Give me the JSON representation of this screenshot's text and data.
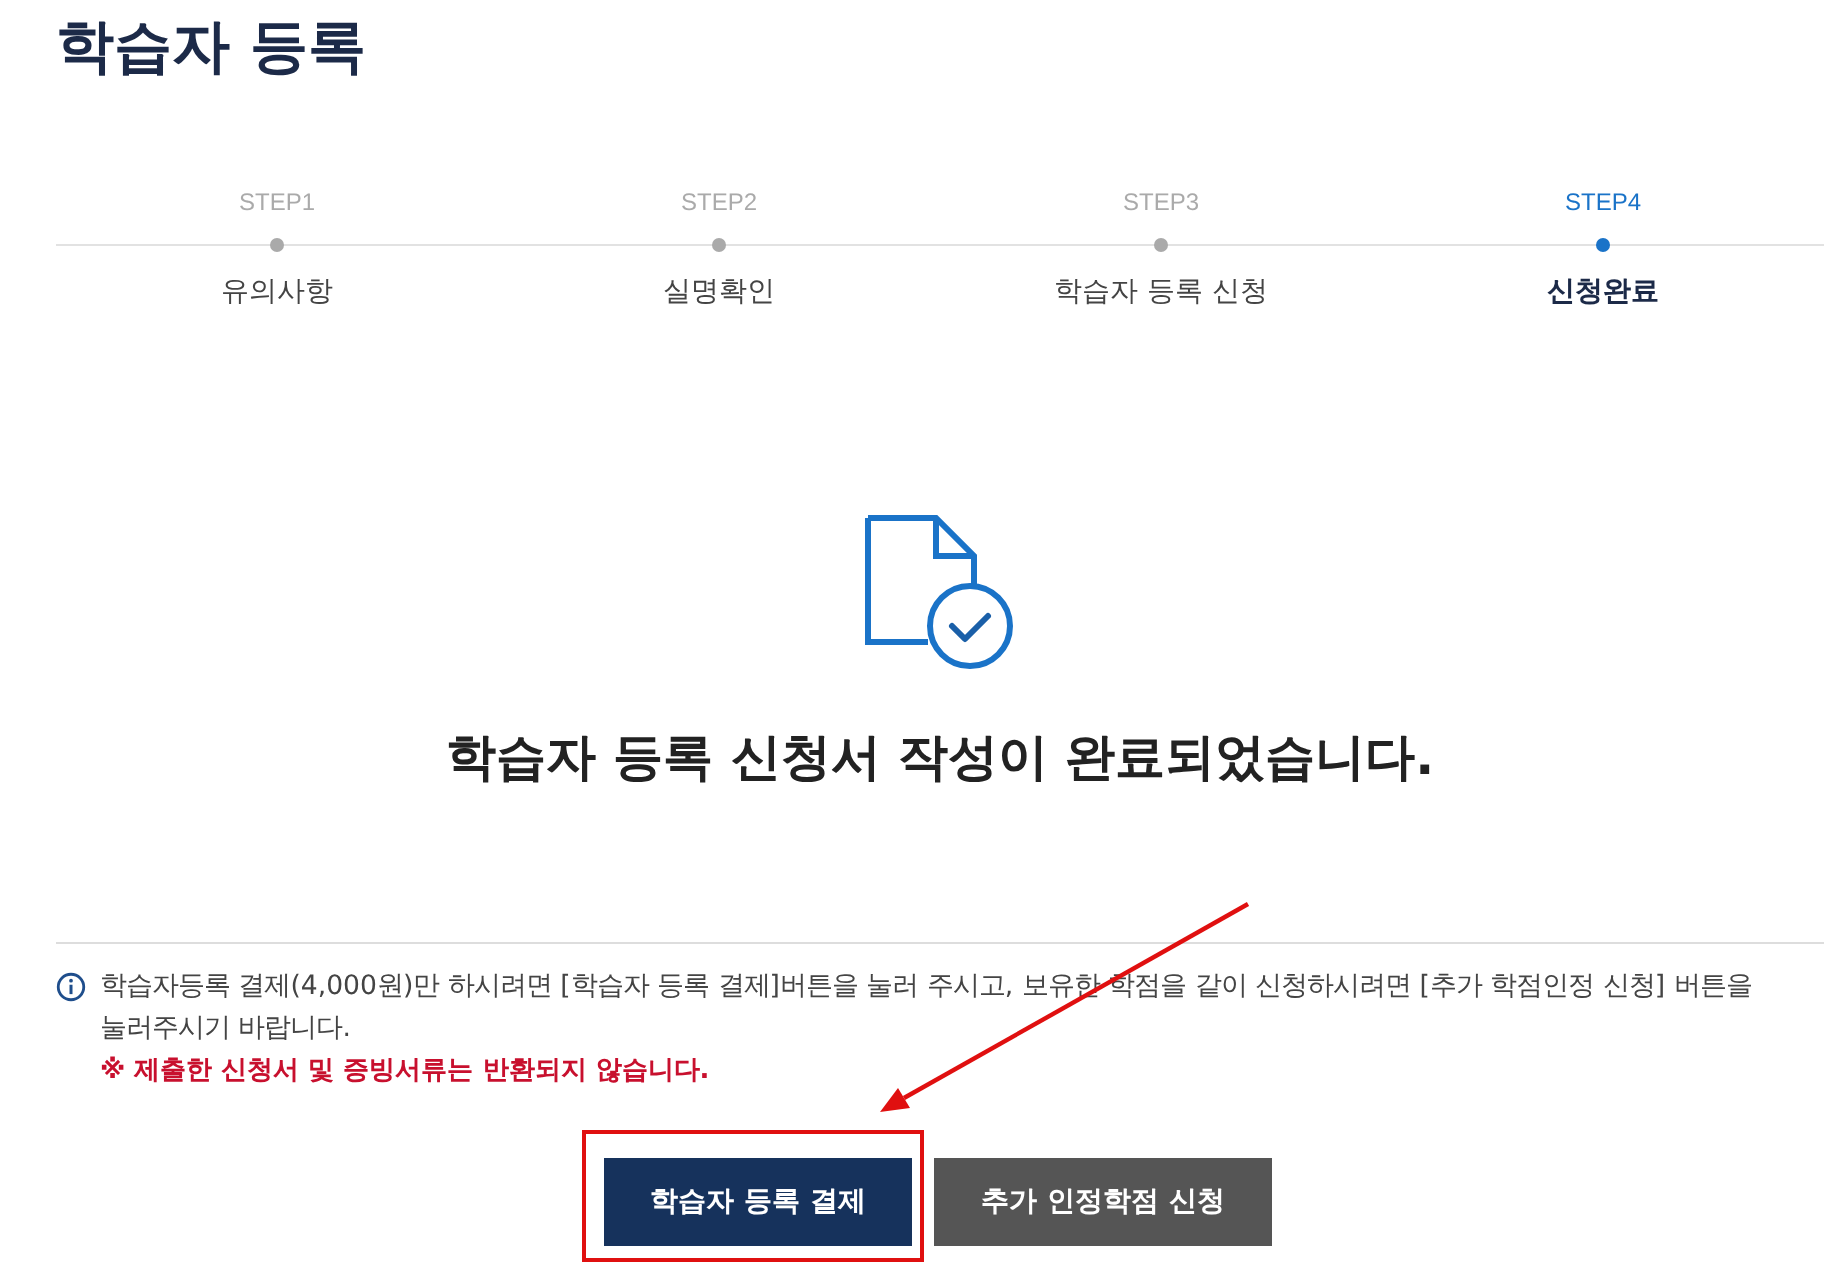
{
  "title": "학습자 등록",
  "steps": [
    {
      "label": "STEP1",
      "name": "유의사항",
      "selected": false
    },
    {
      "label": "STEP2",
      "name": "실명확인",
      "selected": false
    },
    {
      "label": "STEP3",
      "name": "학습자 등록 신청",
      "selected": false
    },
    {
      "label": "STEP4",
      "name": "신청완료",
      "selected": true
    }
  ],
  "result": {
    "message": "학습자 등록 신청서 작성이 완료되었습니다."
  },
  "notice": {
    "text": "학습자등록 결제(4,000원)만 하시려면 [학습자 등록 결제]버튼을 눌러 주시고, 보유한 학점을 같이 신청하시려면 [추가 학점인정 신청] 버튼을 눌러주시기 바랍니다.",
    "warning": "※ 제출한 신청서 및 증빙서류는 반환되지 않습니다."
  },
  "buttons": [
    {
      "label": "학습자 등록 결제",
      "kind": "primary",
      "highlighted": true
    },
    {
      "label": "추가 인정학점 신청",
      "kind": "secondary",
      "highlighted": false
    }
  ]
}
